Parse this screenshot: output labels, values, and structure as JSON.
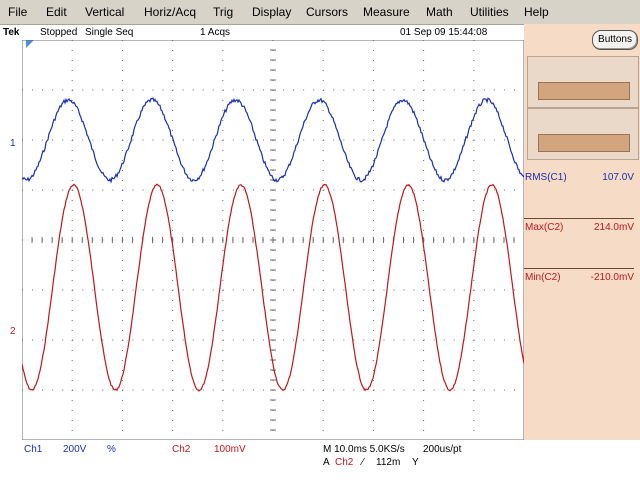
{
  "menu": {
    "file": "File",
    "edit": "Edit",
    "vertical": "Vertical",
    "horiz": "Horiz/Acq",
    "trig": "Trig",
    "display": "Display",
    "cursors": "Cursors",
    "measure": "Measure",
    "math": "Math",
    "utilities": "Utilities",
    "help": "Help"
  },
  "status": {
    "brand": "Tek",
    "state": "Stopped",
    "mode": "Single Seq",
    "acqs": "1 Acqs",
    "datetime": "01 Sep 09 15:44:08"
  },
  "right_panel": {
    "buttons_label": "Buttons",
    "measurements": [
      {
        "label": "RMS(C1)",
        "value": "107.0V",
        "color": "#1a2fb0"
      },
      {
        "label": "Max(C2)",
        "value": "214.0mV",
        "color": "#c0161c"
      },
      {
        "label": "Min(C2)",
        "value": "-210.0mV",
        "color": "#c0161c"
      }
    ]
  },
  "channel_markers": {
    "ch1": "1",
    "ch2": "2"
  },
  "bottom": {
    "ch1_name": "Ch1",
    "ch1_scale": "200V",
    "ch1_coupling": "%",
    "ch2_name": "Ch2",
    "ch2_scale": "100mV",
    "timebase": "M 10.0ms 5.0KS/s",
    "resolution": "200us/pt",
    "trigger_source_prefix": "A",
    "trigger_source": "Ch2",
    "trigger_slope": "⁄",
    "trigger_level": "112m",
    "trigger_unit": "Y"
  },
  "colors": {
    "ch1": "#1a2fb0",
    "ch2": "#c0161c",
    "graticule": "#6b6b6b",
    "panel": "#f6dcc6",
    "accent_blue": "#4a90e2"
  },
  "waveforms": {
    "ch1": {
      "cycles_on_screen": 6,
      "amplitude_divisions": 1.6,
      "center_division": 1.05
    },
    "ch2": {
      "cycles_on_screen": 6,
      "amplitude_divisions": 4.1,
      "center_division": 5.5
    }
  }
}
